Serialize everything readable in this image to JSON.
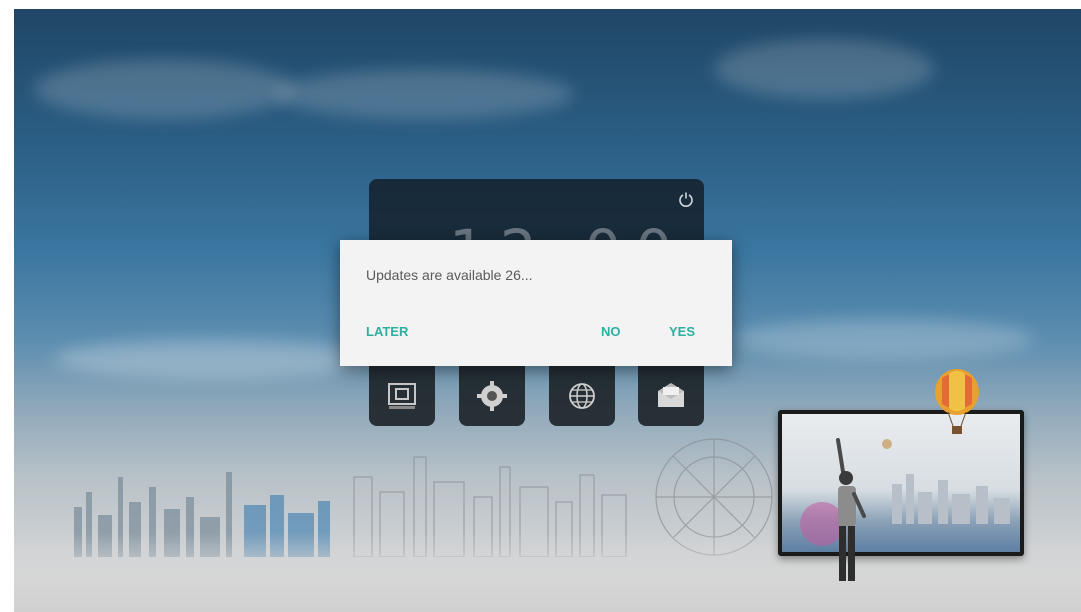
{
  "dialog": {
    "message": "Updates are available 26...",
    "later_label": "LATER",
    "no_label": "NO",
    "yes_label": "YES"
  },
  "launcher": {
    "clock_text": "12:00",
    "apps": [
      {
        "icon": "media-player-icon"
      },
      {
        "icon": "settings-gear-icon"
      },
      {
        "icon": "browser-globe-icon"
      },
      {
        "icon": "mail-envelope-icon"
      }
    ]
  },
  "colors": {
    "accent": "#2eaf9f",
    "dialog_bg": "#f3f3f3",
    "message_text": "#5a5a5a"
  }
}
